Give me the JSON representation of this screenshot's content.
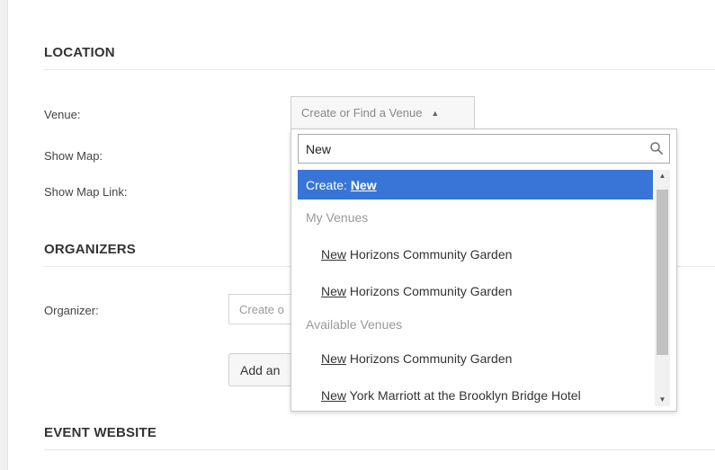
{
  "sections": {
    "location": "LOCATION",
    "organizers": "ORGANIZERS",
    "event_website": "EVENT WEBSITE"
  },
  "labels": {
    "venue": "Venue:",
    "show_map": "Show Map:",
    "show_map_link": "Show Map Link:",
    "organizer": "Organizer:"
  },
  "venue_select": {
    "placeholder": "Create or Find a Venue",
    "arrow": "▲"
  },
  "organizer_field": {
    "placeholder": "Create o"
  },
  "add_button": {
    "label": "Add an"
  },
  "dropdown": {
    "search_value": "New",
    "create_prefix": "Create: ",
    "create_term": "New",
    "groups": [
      {
        "label": "My Venues",
        "items": [
          {
            "match": "New",
            "rest": " Horizons Community Garden"
          },
          {
            "match": "New",
            "rest": " Horizons Community Garden"
          }
        ]
      },
      {
        "label": "Available Venues",
        "items": [
          {
            "match": "New",
            "rest": " Horizons Community Garden"
          },
          {
            "match": "New",
            "rest": " York Marriott at the Brooklyn Bridge Hotel"
          }
        ]
      }
    ]
  },
  "colors": {
    "highlight": "#3875d7",
    "muted_text": "#999999"
  }
}
